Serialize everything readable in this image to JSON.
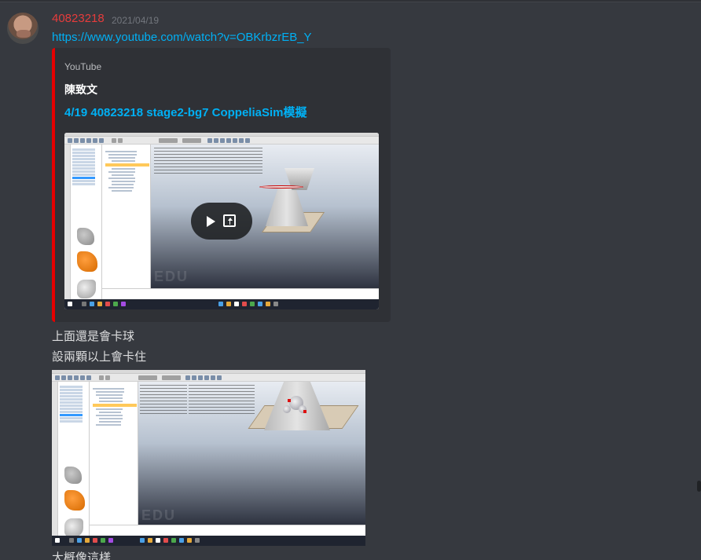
{
  "message": {
    "author": "40823218",
    "timestamp": "2021/04/19",
    "link_text": "https://www.youtube.com/watch?v=OBKrbzrEB_Y",
    "author_color": "#e63c3c",
    "link_color": "#00b0f4"
  },
  "embed": {
    "provider": "YouTube",
    "author": "陳致文",
    "title": "4/19 40823218 stage2-bg7 CoppeliaSim模擬",
    "accent_color": "#e60000",
    "watermark": "EDU",
    "play_icon": "play-icon",
    "open_icon": "open-external-icon"
  },
  "text_lines": [
    "上面還是會卡球",
    "設兩顆以上會卡住",
    "大概像這樣"
  ],
  "attachment": {
    "watermark": "EDU"
  }
}
